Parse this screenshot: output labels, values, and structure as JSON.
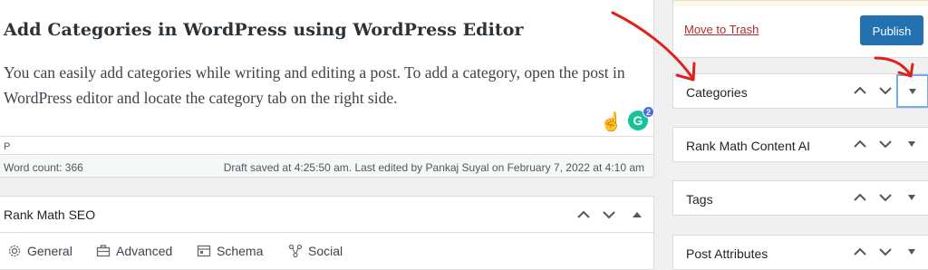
{
  "post": {
    "heading": "Add Categories in WordPress using WordPress Editor",
    "paragraph": "You can easily add categories while writing and editing a post. To add a category, open the post in WordPress editor and locate the category tab on the right side.",
    "grammarly_letter": "G",
    "grammarly_count": "2"
  },
  "status": {
    "path": "P",
    "word_count": "Word count: 366",
    "draft_info": "Draft saved at 4:25:50 am. Last edited by Pankaj Suyal on February 7, 2022 at 4:10 am"
  },
  "rank_math": {
    "title": "Rank Math SEO",
    "tabs": [
      {
        "label": "General",
        "icon": "gear-icon"
      },
      {
        "label": "Advanced",
        "icon": "briefcase-icon"
      },
      {
        "label": "Schema",
        "icon": "schema-icon"
      },
      {
        "label": "Social",
        "icon": "social-icon"
      }
    ]
  },
  "sidebar": {
    "trash_label": "Move to Trash",
    "publish_label": "Publish",
    "boxes": [
      {
        "label": "Categories"
      },
      {
        "label": "Rank Math Content AI"
      },
      {
        "label": "Tags"
      },
      {
        "label": "Post Attributes"
      }
    ]
  },
  "colors": {
    "accent": "#2271b1",
    "trash": "#b32d2e",
    "annotation_arrow": "#e0201a"
  }
}
